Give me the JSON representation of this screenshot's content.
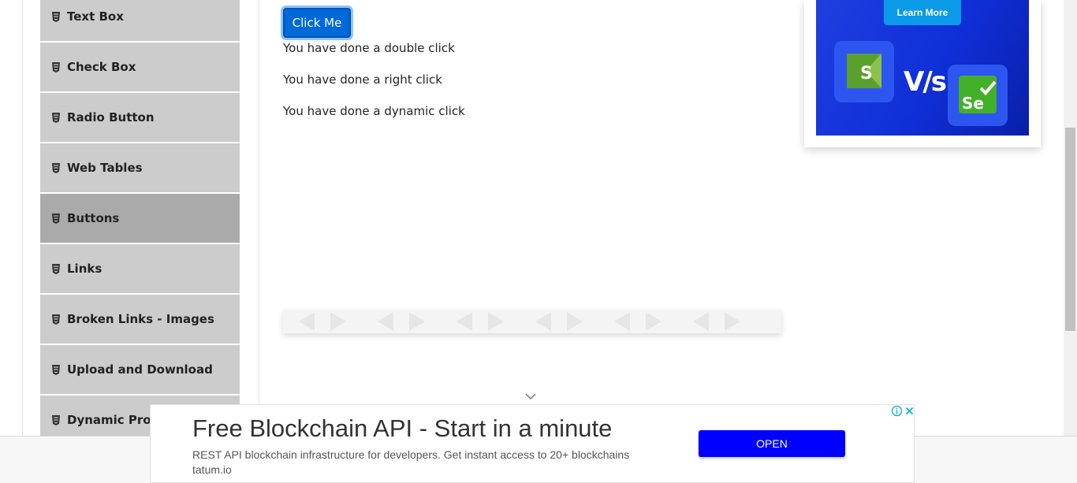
{
  "sidebar": {
    "items": [
      {
        "label": "Text Box",
        "active": false
      },
      {
        "label": "Check Box",
        "active": false
      },
      {
        "label": "Radio Button",
        "active": false
      },
      {
        "label": "Web Tables",
        "active": false
      },
      {
        "label": "Buttons",
        "active": true
      },
      {
        "label": "Links",
        "active": false
      },
      {
        "label": "Broken Links - Images",
        "active": false
      },
      {
        "label": "Upload and Download",
        "active": false
      },
      {
        "label": "Dynamic Prop",
        "active": false
      }
    ]
  },
  "main": {
    "click_button_label": "Click Me",
    "messages": [
      "You have done a double click",
      "You have done a right click",
      "You have done a dynamic click"
    ]
  },
  "ad_right": {
    "button_label": "Learn More",
    "vs_text": "V/s",
    "logo_left_letter": "S",
    "logo_right_letters": "Se"
  },
  "ad_bottom": {
    "title": "Free Blockchain API - Start in a minute",
    "description": "REST API blockchain infrastructure for developers. Get instant access to 20+ blockchains tatum.io",
    "open_label": "OPEN"
  },
  "colors": {
    "primary_button": "#0069d9",
    "sidebar_bg": "#cccccc",
    "sidebar_active_bg": "#aaaaaa",
    "ad_open_button": "#0000ff"
  }
}
